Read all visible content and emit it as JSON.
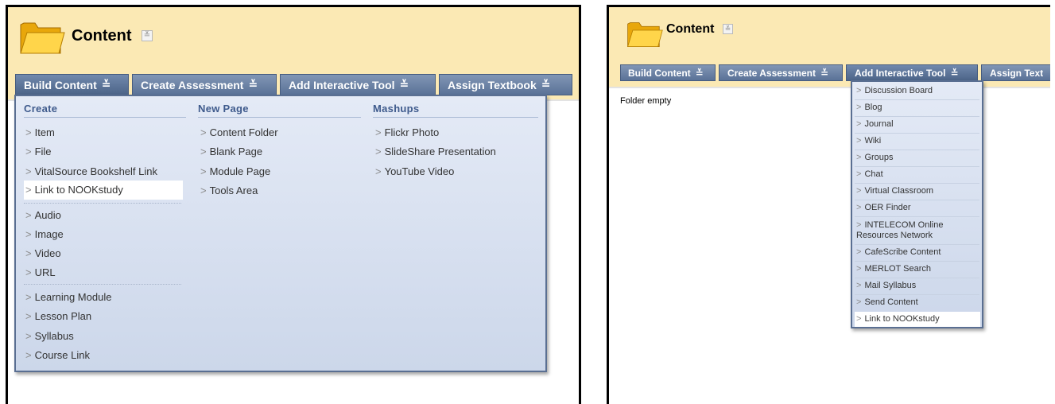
{
  "left": {
    "title": "Content",
    "title_chevron": "≚",
    "toolbar": [
      {
        "label": "Build Content",
        "chevron": "≚"
      },
      {
        "label": "Create Assessment",
        "chevron": "≚"
      },
      {
        "label": "Add Interactive Tool",
        "chevron": "≚"
      },
      {
        "label": "Assign Textbook",
        "chevron": "≚"
      }
    ],
    "menu": {
      "create": {
        "heading": "Create",
        "items": [
          "Item",
          "File",
          "VitalSource Bookshelf Link",
          "Link to NOOKstudy",
          "Audio",
          "Image",
          "Video",
          "URL",
          "Learning Module",
          "Lesson Plan",
          "Syllabus",
          "Course Link"
        ]
      },
      "new_page": {
        "heading": "New Page",
        "items": [
          "Content Folder",
          "Blank Page",
          "Module Page",
          "Tools Area"
        ]
      },
      "mashups": {
        "heading": "Mashups",
        "items": [
          "Flickr Photo",
          "SlideShare Presentation",
          "YouTube Video"
        ]
      }
    }
  },
  "right": {
    "title": "Content",
    "title_chevron": "≚",
    "toolbar": [
      {
        "label": "Build Content",
        "chevron": "≚"
      },
      {
        "label": "Create Assessment",
        "chevron": "≚"
      },
      {
        "label": "Add Interactive Tool",
        "chevron": "≚"
      },
      {
        "label": "Assign Text"
      }
    ],
    "empty_text": "Folder empty",
    "menu_items": [
      "Discussion Board",
      "Blog",
      "Journal",
      "Wiki",
      "Groups",
      "Chat",
      "Virtual Classroom",
      "OER Finder",
      "INTELECOM Online Resources Network",
      "CafeScribe Content",
      "MERLOT Search",
      "Mail Syllabus",
      "Send Content",
      "Link to NOOKstudy"
    ]
  },
  "arrow_glyph": ">",
  "colors": {
    "header_bg": "#fbe9b4",
    "toolbar_button": "#6a80a3",
    "menu_bg": "#dbe3f1",
    "menu_heading": "#3e5a8c",
    "highlight": "#ffffff"
  }
}
